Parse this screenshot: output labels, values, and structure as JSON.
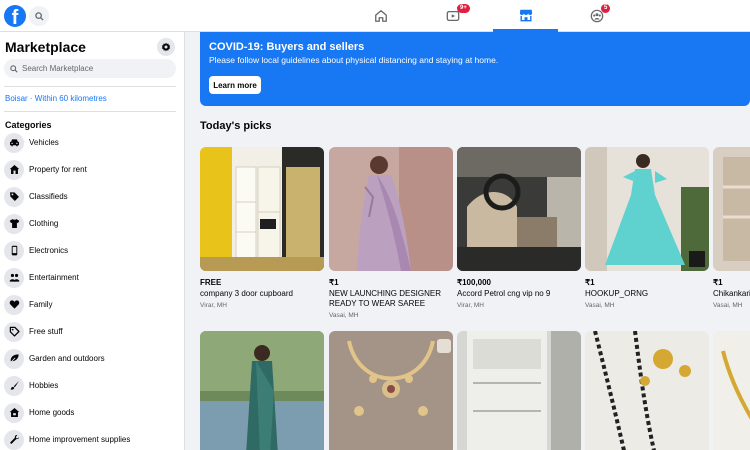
{
  "nav": {
    "logo_letter": "f",
    "tabs": [
      {
        "name": "home"
      },
      {
        "name": "watch",
        "badge": "9+"
      },
      {
        "name": "marketplace",
        "active": true
      },
      {
        "name": "groups",
        "badge": "5"
      }
    ],
    "accent": "#1877f2",
    "badge_color": "#e41e3f"
  },
  "sidebar": {
    "title": "Marketplace",
    "search_placeholder": "Search Marketplace",
    "location": "Boisar · Within 60 kilometres",
    "categories_title": "Categories",
    "categories": [
      {
        "label": "Vehicles",
        "icon": "car-icon"
      },
      {
        "label": "Property for rent",
        "icon": "house-icon"
      },
      {
        "label": "Classifieds",
        "icon": "tag-icon"
      },
      {
        "label": "Clothing",
        "icon": "shirt-icon"
      },
      {
        "label": "Electronics",
        "icon": "phone-icon"
      },
      {
        "label": "Entertainment",
        "icon": "people-icon"
      },
      {
        "label": "Family",
        "icon": "heart-icon"
      },
      {
        "label": "Free stuff",
        "icon": "price-tag-icon"
      },
      {
        "label": "Garden and outdoors",
        "icon": "leaf-icon"
      },
      {
        "label": "Hobbies",
        "icon": "brush-icon"
      },
      {
        "label": "Home goods",
        "icon": "home-goods-icon"
      },
      {
        "label": "Home improvement supplies",
        "icon": "wrench-icon"
      }
    ]
  },
  "banner": {
    "title": "COVID-19: Buyers and sellers",
    "text": "Please follow local guidelines about physical distancing and staying at home.",
    "button": "Learn more"
  },
  "picks": {
    "title": "Today's picks",
    "listings": [
      {
        "price": "FREE",
        "title": "company 3 door cupboard",
        "location": "Virar, MH"
      },
      {
        "price": "₹1",
        "title": "NEW LAUNCHING DESIGNER READY TO WEAR SAREE",
        "location": "Vasai, MH"
      },
      {
        "price": "₹100,000",
        "title": "Accord Petrol cng vip no 9",
        "location": "Virar, MH"
      },
      {
        "price": "₹1",
        "title": "HOOKUP_ORNG",
        "location": "Vasai, MH"
      },
      {
        "price": "₹1",
        "title": "Chikankari",
        "location": "Vasai, MH"
      }
    ]
  }
}
